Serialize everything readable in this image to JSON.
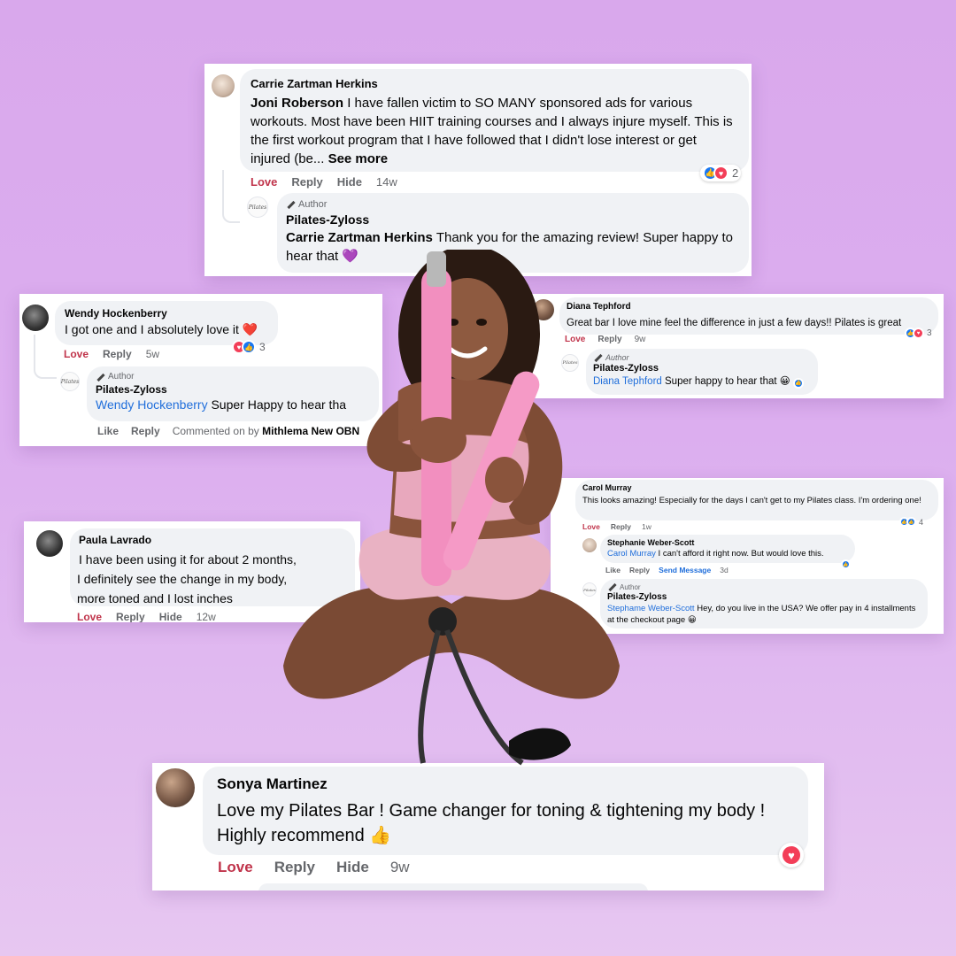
{
  "colors": {
    "background": "#dcaeef",
    "card": "#ffffff",
    "bubble": "#f0f2f5",
    "love_action": "#c0344b",
    "link_blue": "#216fdb",
    "bar_pink": "#f28fbf"
  },
  "card1": {
    "name": "Carrie Zartman Herkins",
    "mention": "Joni Roberson",
    "text": "I have fallen victim to SO MANY sponsored ads for various workouts. Most have been HIIT training courses and I always injure myself. This is the first workout program that I have followed that I didn't lose interest or get injured (be...",
    "see_more": "See more",
    "actions": {
      "love": "Love",
      "reply": "Reply",
      "hide": "Hide",
      "time": "14w"
    },
    "react_count": "2",
    "reply": {
      "author_label": "Author",
      "name": "Pilates-Zyloss",
      "mention": "Carrie Zartman Herkins",
      "text": "Thank you for the amazing review! Super happy to hear that"
    }
  },
  "card2": {
    "name": "Wendy Hockenberry",
    "text": "I got one and I absolutely love it",
    "actions": {
      "love": "Love",
      "reply": "Reply",
      "time": "5w"
    },
    "react_count": "3",
    "reply": {
      "author_label": "Author",
      "name": "Pilates-Zyloss",
      "mention": "Wendy Hockenberry",
      "text": "Super Happy to hear tha",
      "like": "Like",
      "reply_label": "Reply",
      "commented_on_by": "Commented on by",
      "commenter": "Mithlema New OBN"
    }
  },
  "card3": {
    "name": "Diana Tephford",
    "text": "Great bar I love mine feel the difference in just a few days!! Pilates is great",
    "actions": {
      "love": "Love",
      "reply": "Reply",
      "time": "9w"
    },
    "react_count": "3",
    "reply": {
      "author_label": "Author",
      "name": "Pilates-Zyloss",
      "mention": "Diana Tephford",
      "text": "Super happy to hear that"
    }
  },
  "card4": {
    "name": "Paula Lavrado",
    "lines": [
      "I have been using it for about 2 months,",
      "I definitely see the change in my body,",
      "more toned and I lost inches"
    ],
    "actions": {
      "love": "Love",
      "reply": "Reply",
      "hide": "Hide",
      "time": "12w"
    }
  },
  "card5": {
    "name": "Carol Murray",
    "text": "This looks amazing! Especially for the days I can't get to my Pilates class. I'm ordering one!",
    "actions": {
      "love": "Love",
      "reply": "Reply",
      "time": "1w"
    },
    "react_count": "4",
    "reply1": {
      "name": "Stephanie Weber-Scott",
      "mention": "Carol Murray",
      "text": "I can't afford it right now. But would love this.",
      "like": "Like",
      "reply_label": "Reply",
      "send": "Send Message",
      "time": "3d"
    },
    "reply2": {
      "author_label": "Author",
      "name": "Pilates-Zyloss",
      "mention": "Stephame Weber-Scott",
      "text": "Hey, do you live in the USA? We offer pay in 4 installments at the checkout page"
    }
  },
  "card6": {
    "name": "Sonya Martinez",
    "text": "Love my Pilates Bar ! Game changer for toning & tightening my body ! Highly recommend",
    "actions": {
      "love": "Love",
      "reply": "Reply",
      "hide": "Hide",
      "time": "9w"
    }
  },
  "logo_text": "Pilates",
  "icons": {
    "heart": "heart-icon",
    "purple_heart": "purple-heart-icon",
    "thumbs_up": "thumbs-up-icon",
    "pencil": "pencil-icon",
    "like_reaction": "like-reaction-icon",
    "love_reaction": "love-reaction-icon"
  }
}
